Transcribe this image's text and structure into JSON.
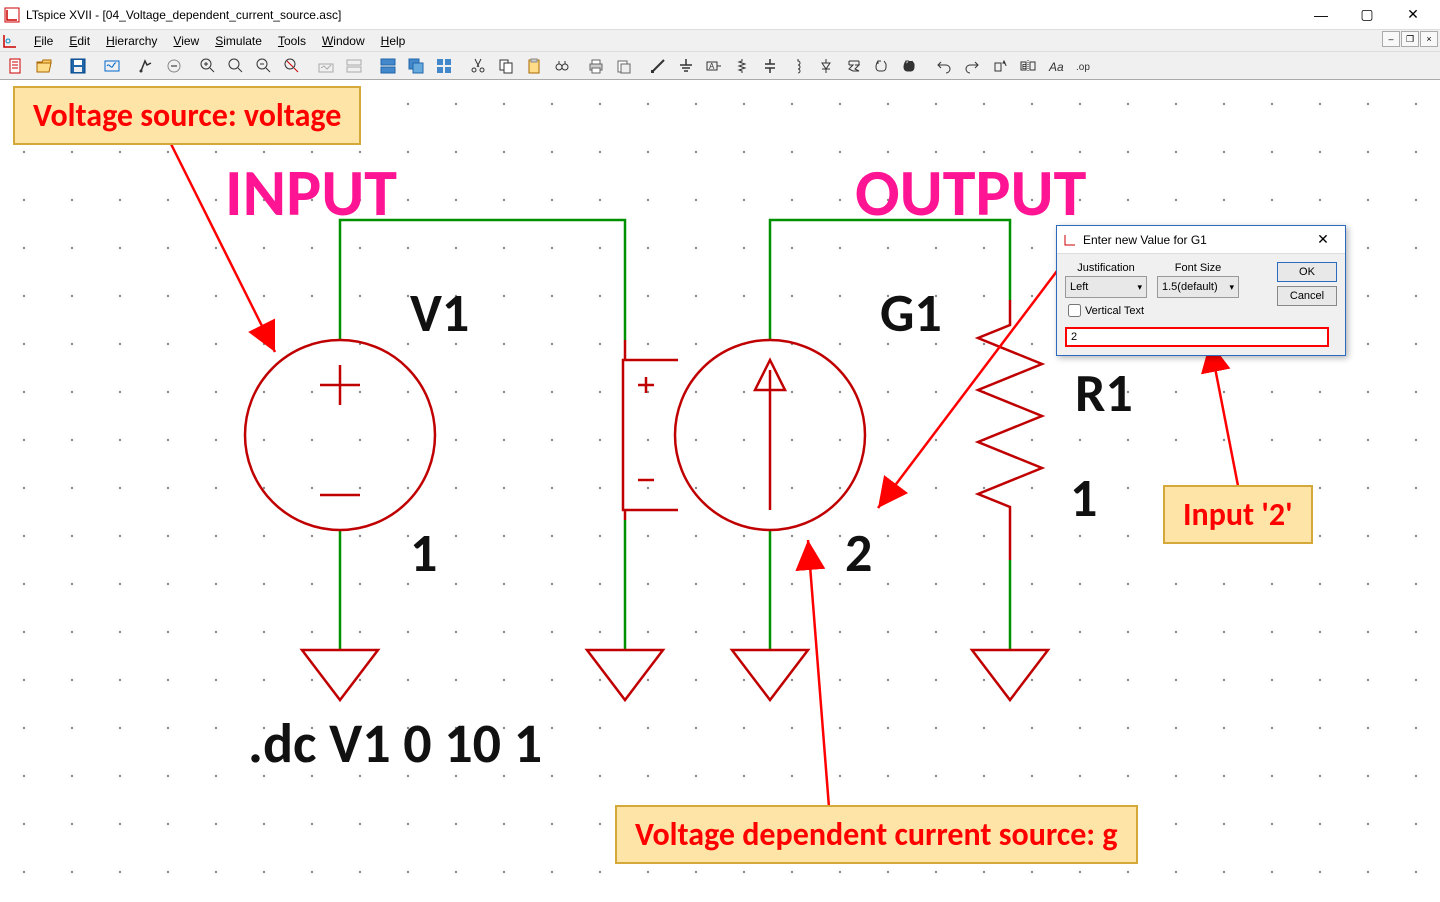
{
  "window": {
    "title": "LTspice XVII - [04_Voltage_dependent_current_source.asc]"
  },
  "menu": {
    "items": [
      "File",
      "Edit",
      "Hierarchy",
      "View",
      "Simulate",
      "Tools",
      "Window",
      "Help"
    ]
  },
  "annotations": {
    "voltage_source": "Voltage source: voltage",
    "vdcs": "Voltage dependent current source: g",
    "input2": "Input '2'"
  },
  "schematic": {
    "input_label": "INPUT",
    "output_label": "OUTPUT",
    "v1_name": "V1",
    "v1_value": "1",
    "g1_name": "G1",
    "g1_value": "2",
    "r1_name": "R1",
    "r1_value": "1",
    "directive": ".dc V1 0 10 1"
  },
  "dialog": {
    "title": "Enter new Value for G1",
    "justification_label": "Justification",
    "justification_value": "Left",
    "fontsize_label": "Font Size",
    "fontsize_value": "1.5(default)",
    "vertical_text": "Vertical Text",
    "ok": "OK",
    "cancel": "Cancel",
    "input_value": "2"
  }
}
